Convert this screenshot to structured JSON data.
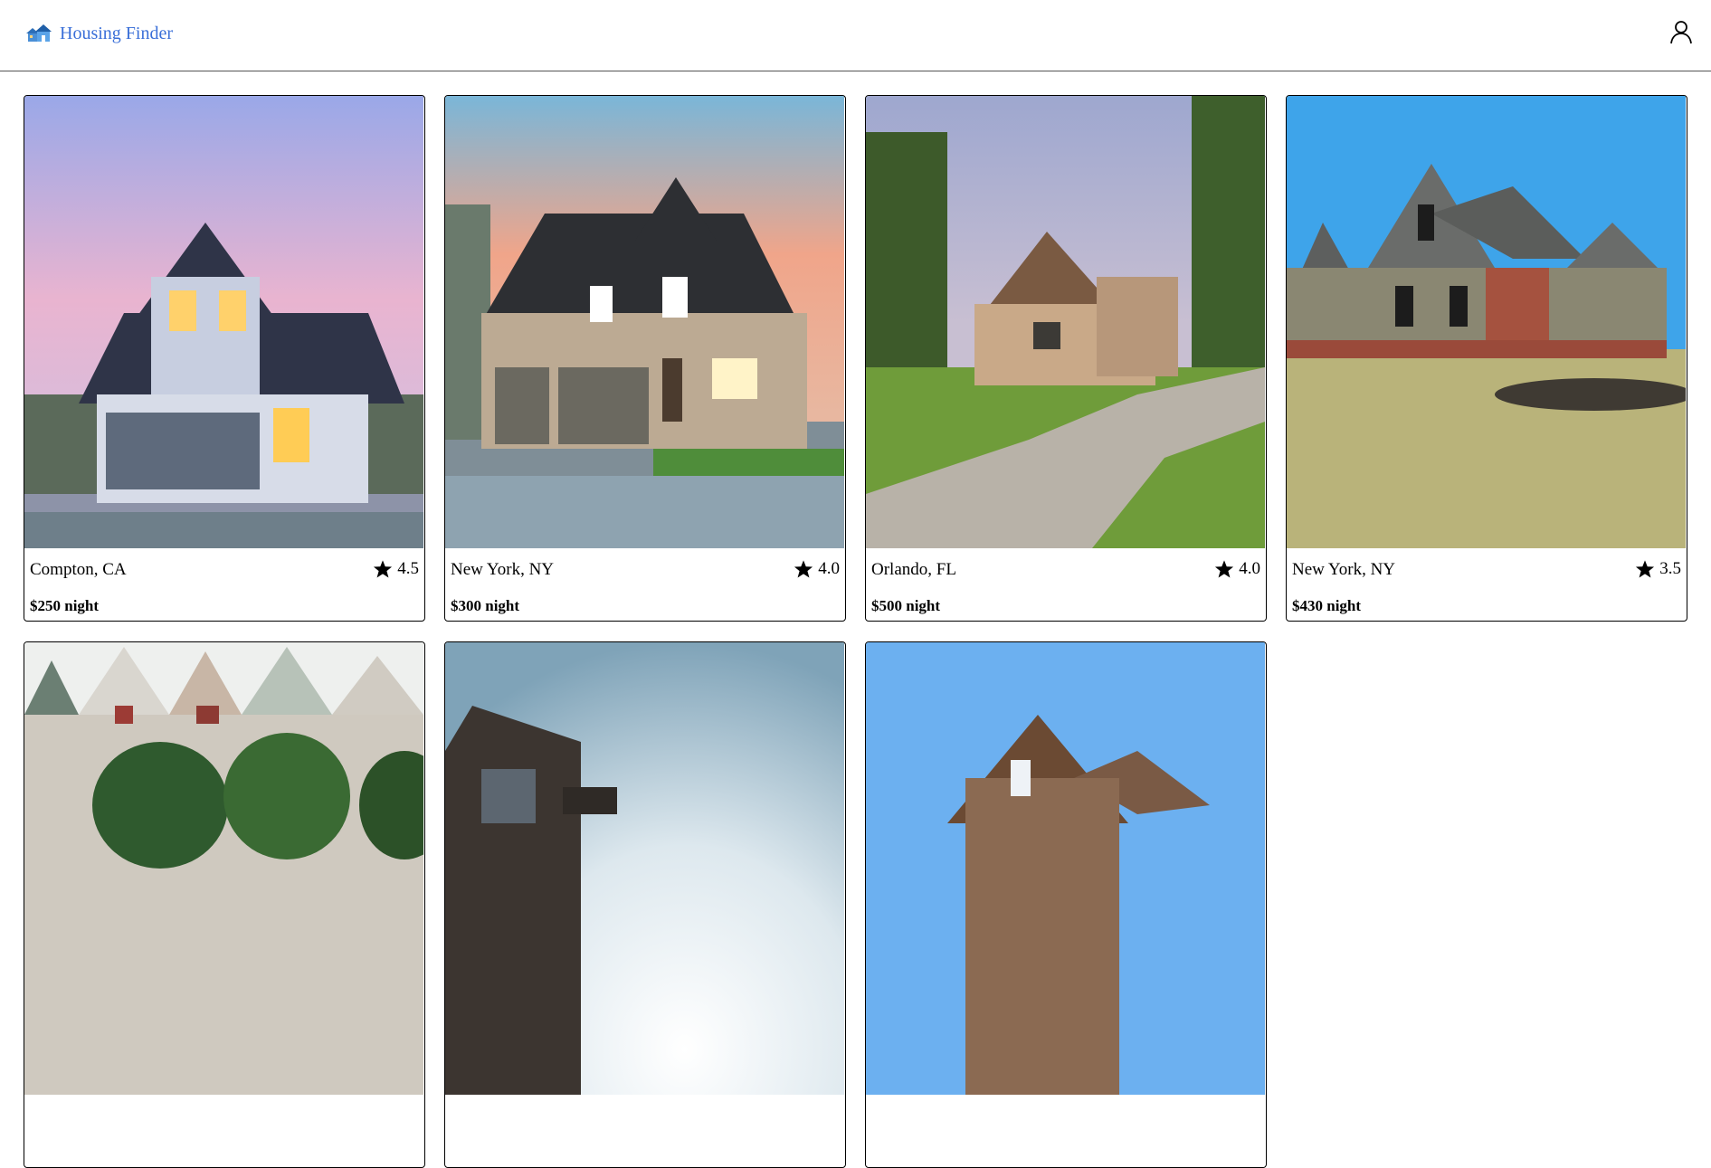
{
  "app": {
    "title": "Housing Finder",
    "logo_icon": "house-logo-icon",
    "user_icon": "user-icon"
  },
  "listings": [
    {
      "location": "Compton, CA",
      "rating": "4.5",
      "price": "$250 night"
    },
    {
      "location": "New York, NY",
      "rating": "4.0",
      "price": "$300 night"
    },
    {
      "location": "Orlando, FL",
      "rating": "4.0",
      "price": "$500 night"
    },
    {
      "location": "New York, NY",
      "rating": "3.5",
      "price": "$430 night"
    },
    {
      "location": "",
      "rating": "",
      "price": ""
    },
    {
      "location": "",
      "rating": "",
      "price": ""
    },
    {
      "location": "",
      "rating": "",
      "price": ""
    }
  ],
  "colors": {
    "brand": "#3a6fd8",
    "border": "#000000",
    "header_rule": "#555555"
  }
}
